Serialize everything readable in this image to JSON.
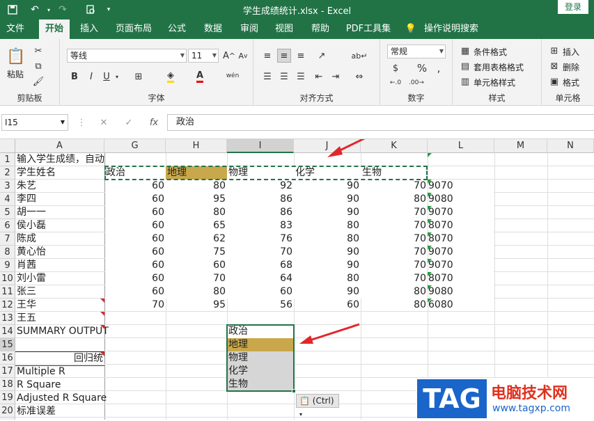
{
  "titlebar": {
    "title": "学生成绩统计.xlsx  -  Excel",
    "login": "登录"
  },
  "tabs": [
    "文件",
    "开始",
    "插入",
    "页面布局",
    "公式",
    "数据",
    "审阅",
    "视图",
    "帮助",
    "PDF工具集",
    "操作说明搜索"
  ],
  "ribbon": {
    "clipboard": {
      "paste": "粘贴",
      "label": "剪贴板"
    },
    "font": {
      "name": "等线",
      "size": "11",
      "label": "字体",
      "bold": "B",
      "italic": "I",
      "underline": "U",
      "phonetic": "wén"
    },
    "alignment": {
      "label": "对齐方式"
    },
    "number": {
      "format": "常规",
      "label": "数字",
      "percent": "%"
    },
    "styles": {
      "cond": "条件格式",
      "table": "套用表格格式",
      "cell": "单元格样式",
      "label": "样式"
    },
    "cells": {
      "insert": "插入",
      "delete": "删除",
      "format": "格式",
      "label": "单元格"
    }
  },
  "formula_bar": {
    "name_box": "I15",
    "fx": "fx",
    "content": "政治"
  },
  "columns": [
    "A",
    "G",
    "H",
    "I",
    "J",
    "K",
    "L",
    "M",
    "N"
  ],
  "rows": [
    "1",
    "2",
    "3",
    "4",
    "5",
    "6",
    "7",
    "8",
    "9",
    "10",
    "11",
    "12",
    "13",
    "14",
    "15",
    "16",
    "17",
    "18",
    "19",
    "20",
    "21"
  ],
  "a_col": {
    "r1": "输入学生成绩，自动",
    "r2": "学生姓名",
    "names": [
      "朱艺",
      "李四",
      "胡一一",
      "侯小磊",
      "陈成",
      "黄心怡",
      "肖茜",
      "刘小雷",
      "张三",
      "王华",
      "王五"
    ],
    "r15": "SUMMARY OUTPUT",
    "r17": "回归统",
    "r18": "Multiple R",
    "r19": "R Square",
    "r20": "Adjusted R Square",
    "r21": "标准误差"
  },
  "headers": [
    "政治",
    "地理",
    "物理",
    "化学",
    "生物"
  ],
  "table": [
    [
      "60",
      "80",
      "92",
      "90",
      "70",
      "9070"
    ],
    [
      "60",
      "95",
      "86",
      "90",
      "80",
      "9080"
    ],
    [
      "60",
      "80",
      "86",
      "90",
      "70",
      "9070"
    ],
    [
      "60",
      "65",
      "83",
      "80",
      "70",
      "8070"
    ],
    [
      "60",
      "62",
      "76",
      "80",
      "70",
      "8070"
    ],
    [
      "60",
      "75",
      "70",
      "90",
      "70",
      "9070"
    ],
    [
      "60",
      "60",
      "68",
      "90",
      "70",
      "9070"
    ],
    [
      "60",
      "70",
      "64",
      "80",
      "70",
      "8070"
    ],
    [
      "60",
      "80",
      "60",
      "90",
      "80",
      "9080"
    ],
    [
      "70",
      "95",
      "56",
      "60",
      "80",
      "6080"
    ]
  ],
  "pasted": [
    "政治",
    "地理",
    "物理",
    "化学",
    "生物"
  ],
  "paste_ctrl": "(Ctrl)",
  "colors": {
    "green": "#217346",
    "highlight": "#c9a84c",
    "selection": "#d6d6d6",
    "arrow": "#e2262b"
  },
  "watermark": {
    "tag": "TAG",
    "name": "电脑技术网",
    "url": "www.tagxp.com"
  }
}
